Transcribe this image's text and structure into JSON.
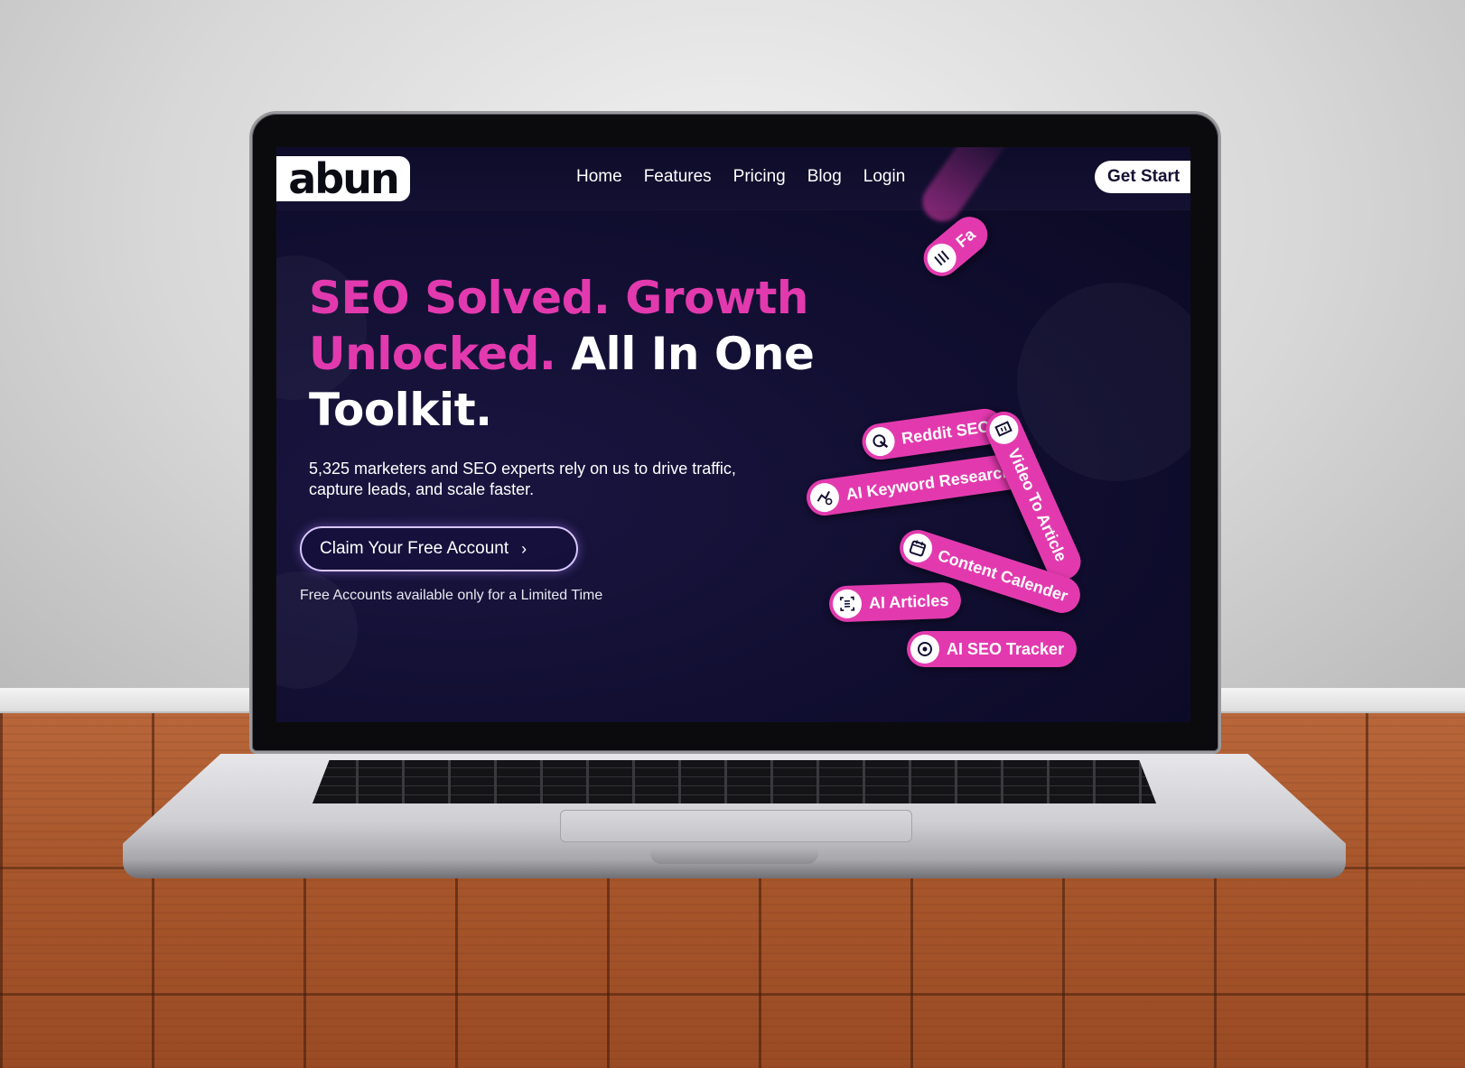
{
  "site": {
    "logo_text": "abun",
    "nav": {
      "links": [
        "Home",
        "Features",
        "Pricing",
        "Blog",
        "Login"
      ],
      "cta": "Get Start"
    },
    "hero": {
      "title_pink": "SEO Solved. Growth Unlocked.",
      "title_white": "All In One Toolkit.",
      "subtitle": "5,325 marketers and SEO experts rely on us to drive traffic, capture leads, and scale faster.",
      "cta_label": "Claim Your Free Account",
      "note": "Free Accounts available only for a Limited Time"
    },
    "features": [
      {
        "label": "Reddit SEO",
        "icon": "cursor-click-icon"
      },
      {
        "label": "AI Keyword Research",
        "icon": "chart-search-icon"
      },
      {
        "label": "Video To Article",
        "icon": "edit-document-icon"
      },
      {
        "label": "Content Calender",
        "icon": "calendar-icon"
      },
      {
        "label": "AI Articles",
        "icon": "document-scan-icon"
      },
      {
        "label": "AI SEO Tracker",
        "icon": "radar-icon"
      },
      {
        "label": "Fa",
        "icon": "bars-icon"
      }
    ],
    "colors": {
      "accent": "#e23aae",
      "background": "#120f33",
      "text": "#ffffff"
    }
  }
}
